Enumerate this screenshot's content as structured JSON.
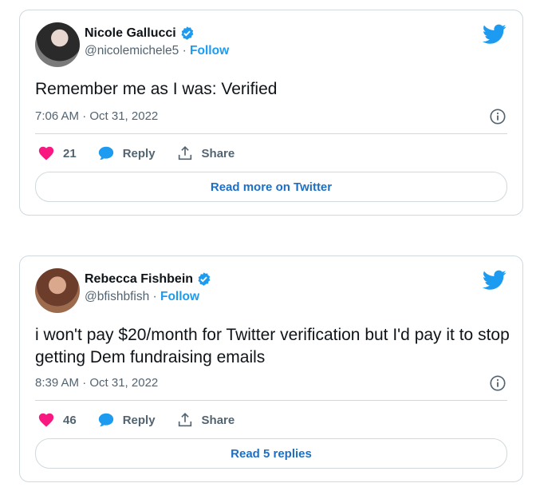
{
  "colors": {
    "accent": "#1d9bf0",
    "like": "#f91880",
    "border": "#cfd9de",
    "muted": "#536471"
  },
  "tweets": [
    {
      "author_name": "Nicole Gallucci",
      "handle": "@nicolemichele5",
      "separator": "·",
      "follow_label": "Follow",
      "text": "Remember me as I was: Verified",
      "timestamp": "7:06 AM · Oct 31, 2022",
      "likes": "21",
      "reply_label": "Reply",
      "share_label": "Share",
      "cta_label": "Read more on Twitter",
      "icons": [
        "avatar",
        "verified-badge-icon",
        "twitter-bird-icon",
        "info-icon",
        "heart-icon",
        "reply-bubble-icon",
        "share-icon"
      ]
    },
    {
      "author_name": "Rebecca Fishbein",
      "handle": "@bfishbfish",
      "separator": "·",
      "follow_label": "Follow",
      "text": "i won't pay $20/month for Twitter verification but I'd pay it to stop getting Dem fundraising emails",
      "timestamp": "8:39 AM · Oct 31, 2022",
      "likes": "46",
      "reply_label": "Reply",
      "share_label": "Share",
      "cta_label": "Read 5 replies",
      "icons": [
        "avatar",
        "verified-badge-icon",
        "twitter-bird-icon",
        "info-icon",
        "heart-icon",
        "reply-bubble-icon",
        "share-icon"
      ]
    }
  ]
}
